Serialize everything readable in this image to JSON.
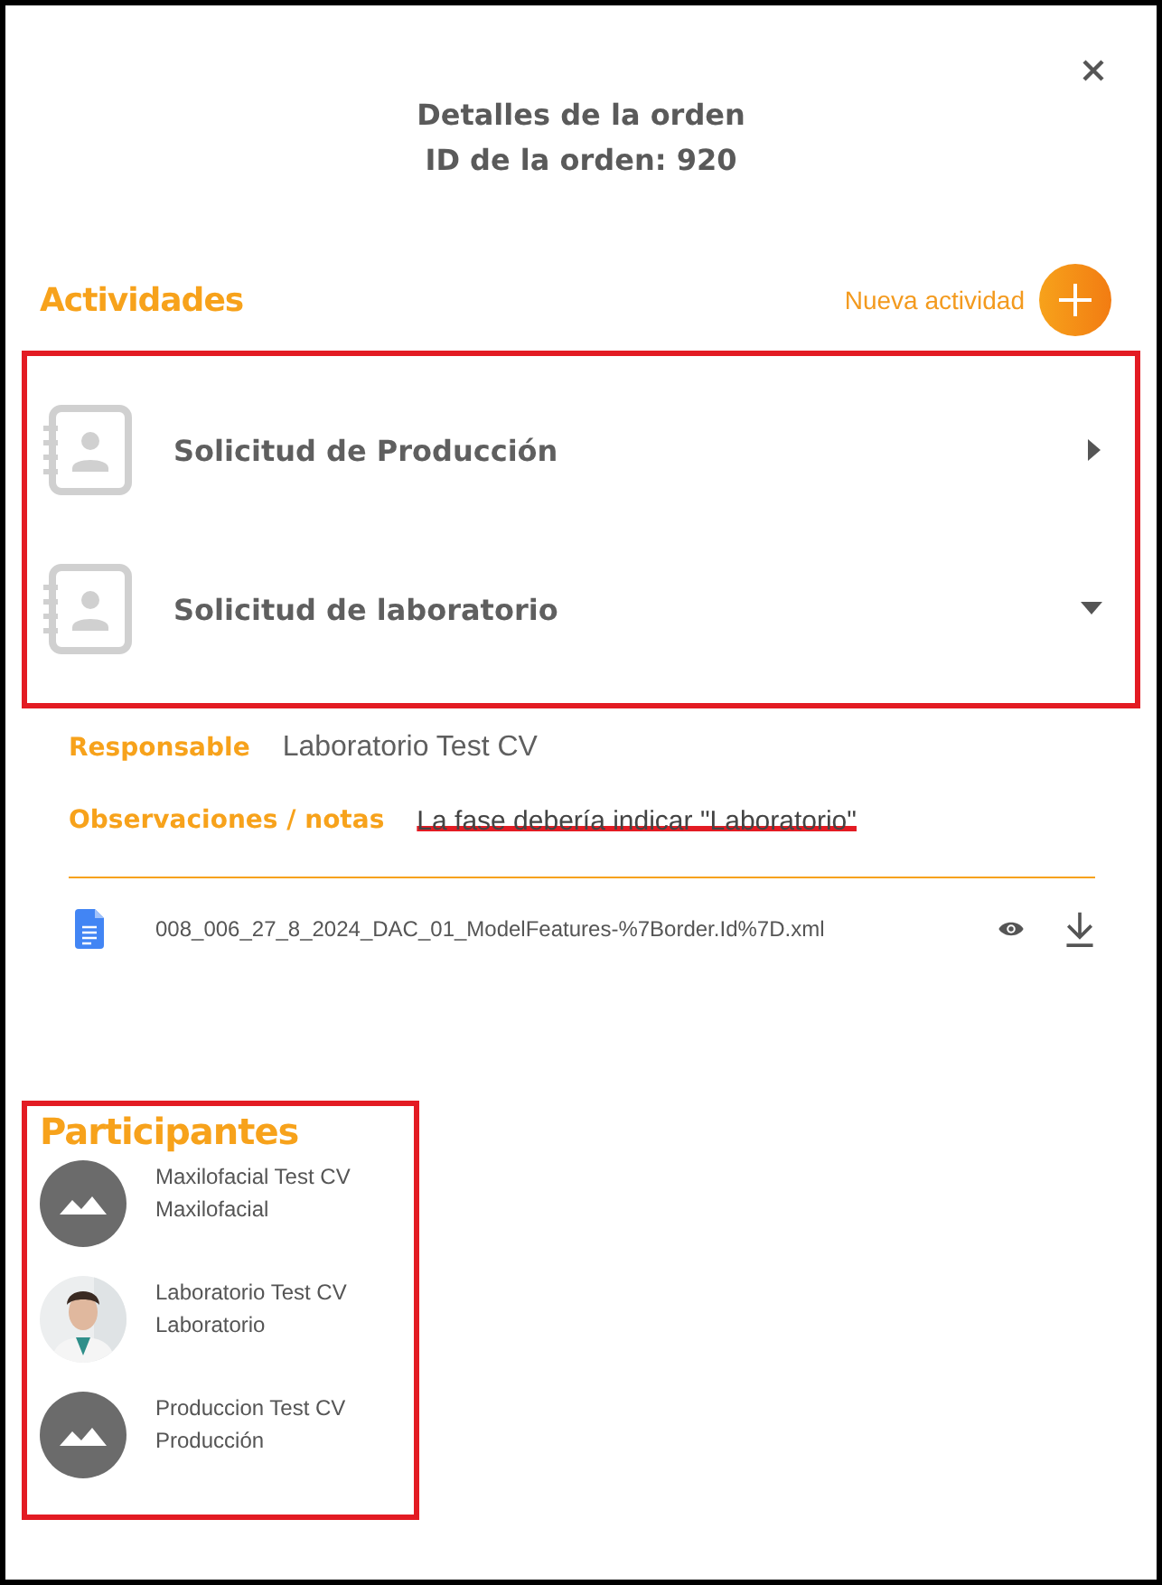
{
  "dialog": {
    "title": "Detalles de la orden",
    "subtitle": "ID de la orden: 920"
  },
  "activities_section": {
    "heading": "Actividades",
    "new_button": "Nueva actividad",
    "annotated": true,
    "items": [
      {
        "title": "Solicitud de Producción",
        "expanded": false
      },
      {
        "title": "Solicitud de laboratorio",
        "expanded": true
      }
    ]
  },
  "activity_details": {
    "fields": [
      {
        "label": "Responsable",
        "value": "Laboratorio Test CV",
        "struck": false
      },
      {
        "label": "Observaciones / notas",
        "value": "La fase debería indicar \"Laboratorio\"",
        "struck": true
      }
    ],
    "files": [
      {
        "name": "008_006_27_8_2024_DAC_01_ModelFeatures-%7Border.Id%7D.xml"
      }
    ]
  },
  "participants_section": {
    "heading": "Participantes",
    "annotated": true,
    "items": [
      {
        "name": "Maxilofacial Test CV",
        "role": "Maxilofacial",
        "kind": "placeholder"
      },
      {
        "name": "Laboratorio Test CV",
        "role": "Laboratorio",
        "kind": "picture"
      },
      {
        "name": "Produccion Test CV",
        "role": "Producción",
        "kind": "placeholder"
      }
    ]
  }
}
